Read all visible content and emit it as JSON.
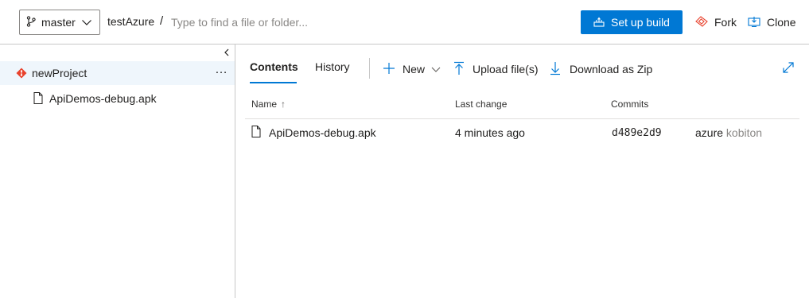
{
  "header": {
    "branch": "master",
    "repo": "testAzure",
    "separator": "/",
    "search_placeholder": "Type to find a file or folder...",
    "setup_build_label": "Set up build",
    "fork_label": "Fork",
    "clone_label": "Clone"
  },
  "tree": {
    "root_label": "newProject",
    "more_label": "…",
    "files": [
      "ApiDemos-debug.apk"
    ]
  },
  "tabs": [
    {
      "label": "Contents",
      "active": true
    },
    {
      "label": "History",
      "active": false
    }
  ],
  "commands": {
    "new_label": "New",
    "upload_label": "Upload file(s)",
    "download_label": "Download as Zip"
  },
  "table": {
    "columns": [
      "Name",
      "Last change",
      "Commits"
    ],
    "sort_indicator": "↑",
    "rows": [
      {
        "name": "ApiDemos-debug.apk",
        "last_change": "4 minutes ago",
        "commit": "d489e2d9",
        "author": "azure",
        "author_sub": "kobiton"
      }
    ]
  },
  "colors": {
    "accent": "#0078d4",
    "git_icon": "#e8412c",
    "fork_icon": "#e8412c",
    "selected_row_bg": "#eff6fc"
  },
  "icons": {
    "branch": "branch-icon",
    "build": "build-icon",
    "fork": "fork-icon",
    "clone": "clone-icon",
    "collapse": "chevron-left-icon",
    "git": "git-diamond-icon",
    "file": "file-icon",
    "new": "plus-icon",
    "upload": "upload-icon",
    "download": "download-icon",
    "expand": "expand-icon"
  }
}
